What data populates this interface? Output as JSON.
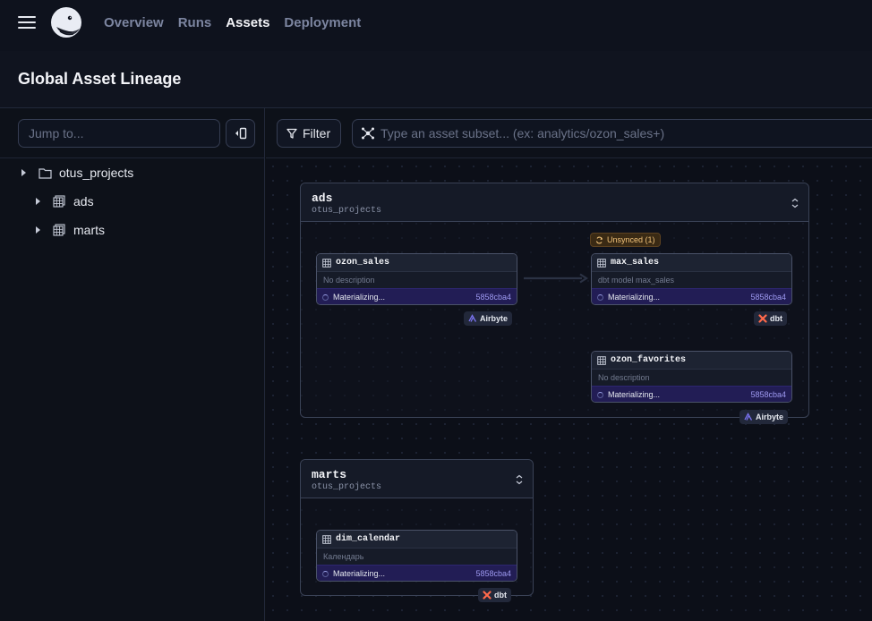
{
  "nav": {
    "links": [
      "Overview",
      "Runs",
      "Assets",
      "Deployment"
    ],
    "active": "Assets"
  },
  "page": {
    "title": "Global Asset Lineage"
  },
  "sidebar": {
    "search_placeholder": "Jump to...",
    "tree": [
      {
        "label": "otus_projects",
        "icon": "folder-icon"
      },
      {
        "label": "ads",
        "icon": "table-group-icon"
      },
      {
        "label": "marts",
        "icon": "table-group-icon"
      }
    ]
  },
  "toolbar": {
    "filter_label": "Filter",
    "subset_placeholder": "Type an asset subset... (ex: analytics/ozon_sales+)"
  },
  "groups": [
    {
      "name": "ads",
      "location": "otus_projects",
      "nodes": [
        {
          "name": "ozon_sales",
          "description": "No description",
          "status": "Materializing...",
          "hash": "5858cba4",
          "tag": "Airbyte"
        },
        {
          "name": "max_sales",
          "description": "dbt model max_sales",
          "status": "Materializing...",
          "hash": "5858cba4",
          "tag": "dbt",
          "badge": "Unsynced (1)"
        },
        {
          "name": "ozon_favorites",
          "description": "No description",
          "status": "Materializing...",
          "hash": "5858cba4",
          "tag": "Airbyte"
        }
      ]
    },
    {
      "name": "marts",
      "location": "otus_projects",
      "nodes": [
        {
          "name": "dim_calendar",
          "description": "Календарь",
          "status": "Materializing...",
          "hash": "5858cba4",
          "tag": "dbt"
        }
      ]
    }
  ],
  "colors": {
    "status_bg": "#221d55",
    "hash": "#9d99f0",
    "dbt": "#ff694b",
    "airbyte": "#7a73f0",
    "unsynced": "#f2c37a"
  }
}
